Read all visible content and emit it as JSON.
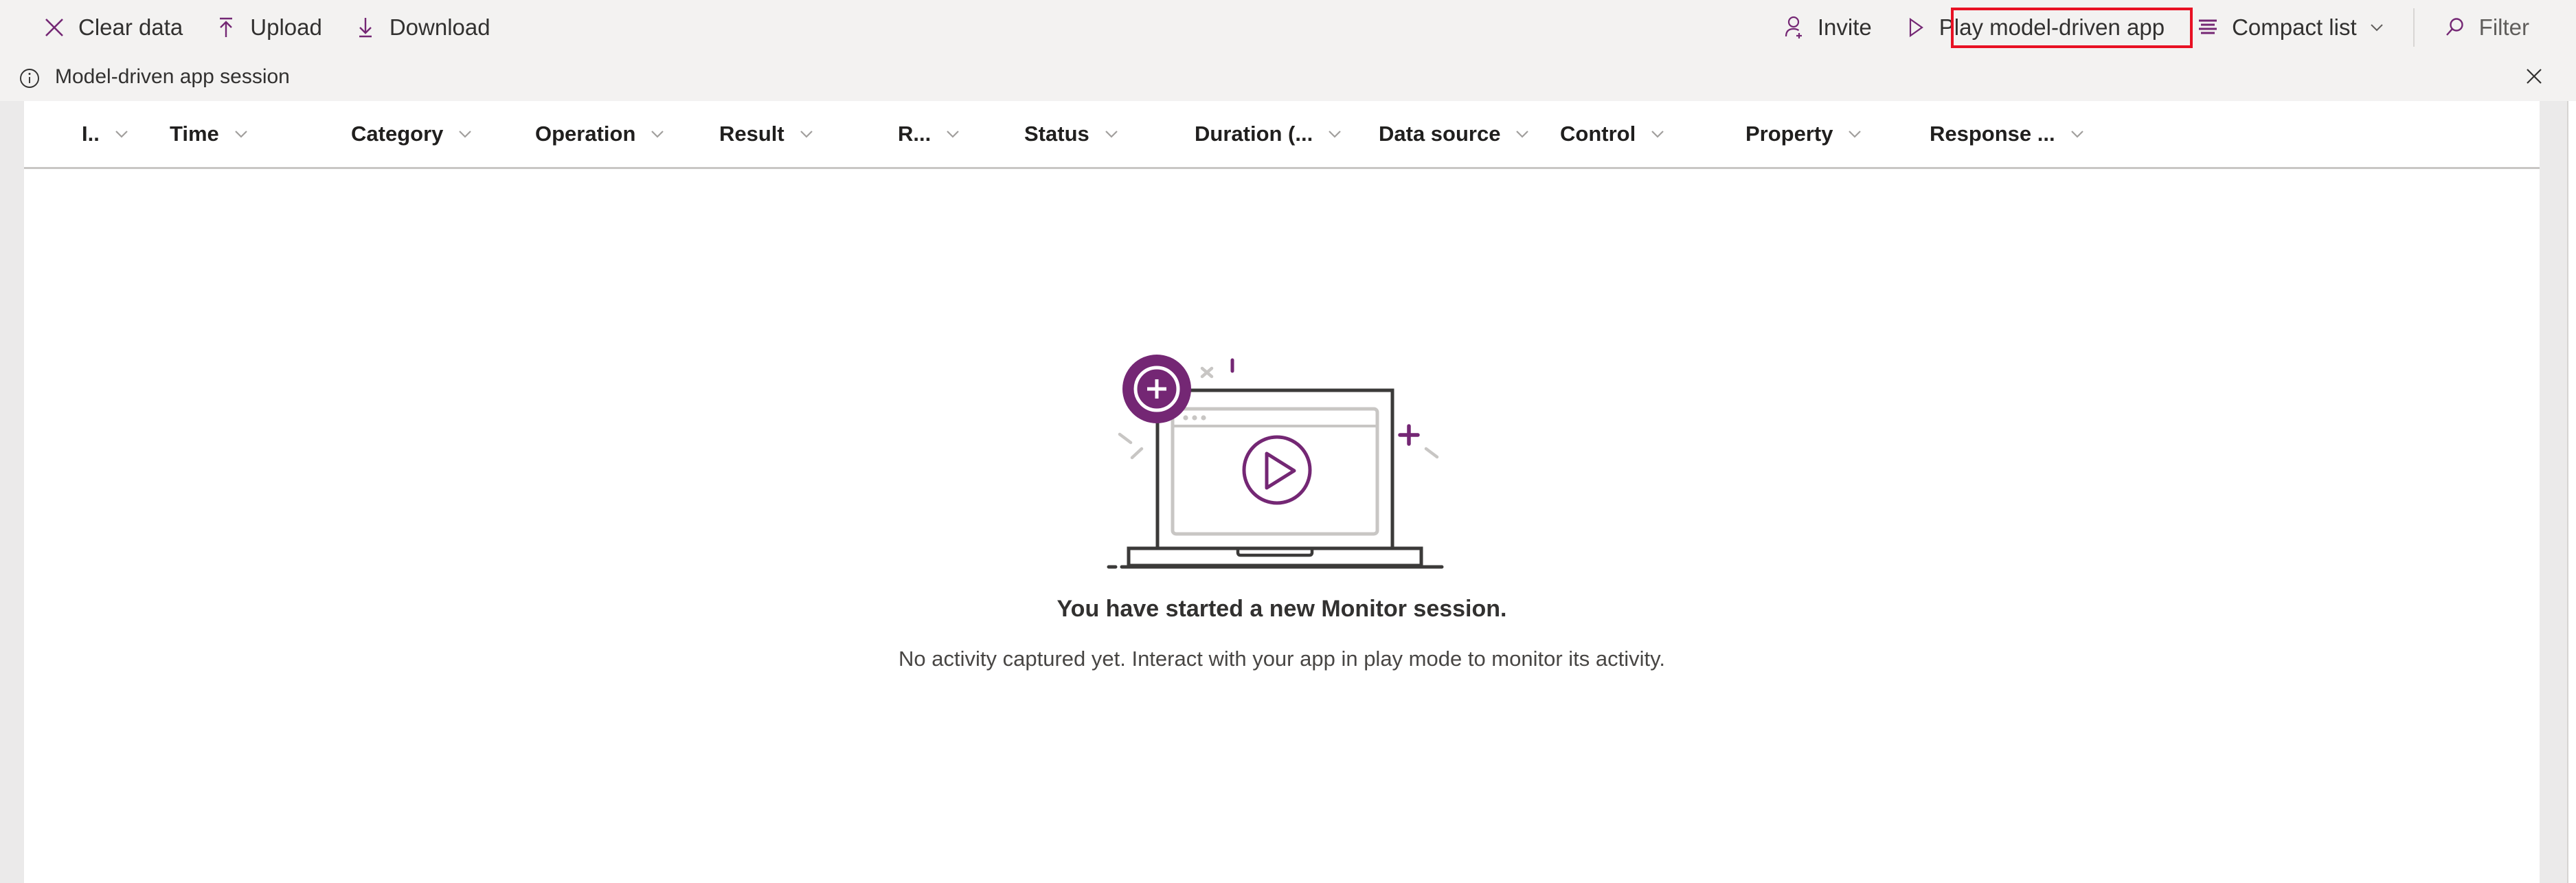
{
  "toolbar": {
    "left_items": [
      {
        "label": "Clear data",
        "icon": "close-x-icon",
        "name": "clear-data-button"
      },
      {
        "label": "Upload",
        "icon": "upload-arrow-icon",
        "name": "upload-button"
      },
      {
        "label": "Download",
        "icon": "download-arrow-icon",
        "name": "download-button"
      }
    ],
    "right_items": [
      {
        "label": "Invite",
        "icon": "person-add-icon",
        "name": "invite-button"
      },
      {
        "label": "Play model-driven app",
        "icon": "play-triangle-icon",
        "name": "play-model-driven-app-button"
      },
      {
        "label": "Compact list",
        "icon": "list-lines-icon",
        "name": "compact-list-button"
      },
      {
        "label": "Filter",
        "icon": "search-icon",
        "name": "filter-button"
      }
    ],
    "highlight_color": "#e81123",
    "accent_color": "#742774"
  },
  "infobar": {
    "icon": "info-circle-icon",
    "message": "Model-driven app session",
    "close_label": "Close"
  },
  "table": {
    "columns": [
      {
        "label": "I..",
        "name": "column-index"
      },
      {
        "label": "Time",
        "name": "column-time"
      },
      {
        "label": "Category",
        "name": "column-category"
      },
      {
        "label": "Operation",
        "name": "column-operation"
      },
      {
        "label": "Result",
        "name": "column-result"
      },
      {
        "label": "R...",
        "name": "column-r"
      },
      {
        "label": "Status",
        "name": "column-status"
      },
      {
        "label": "Duration (...",
        "name": "column-duration"
      },
      {
        "label": "Data source",
        "name": "column-data-source"
      },
      {
        "label": "Control",
        "name": "column-control"
      },
      {
        "label": "Property",
        "name": "column-property"
      },
      {
        "label": "Response ...",
        "name": "column-response"
      }
    ],
    "rows": []
  },
  "empty_state": {
    "illustration": "laptop-with-play-button-illustration",
    "title": "You have started a new Monitor session.",
    "subtitle": "No activity captured yet. Interact with your app in play mode to monitor its activity."
  }
}
